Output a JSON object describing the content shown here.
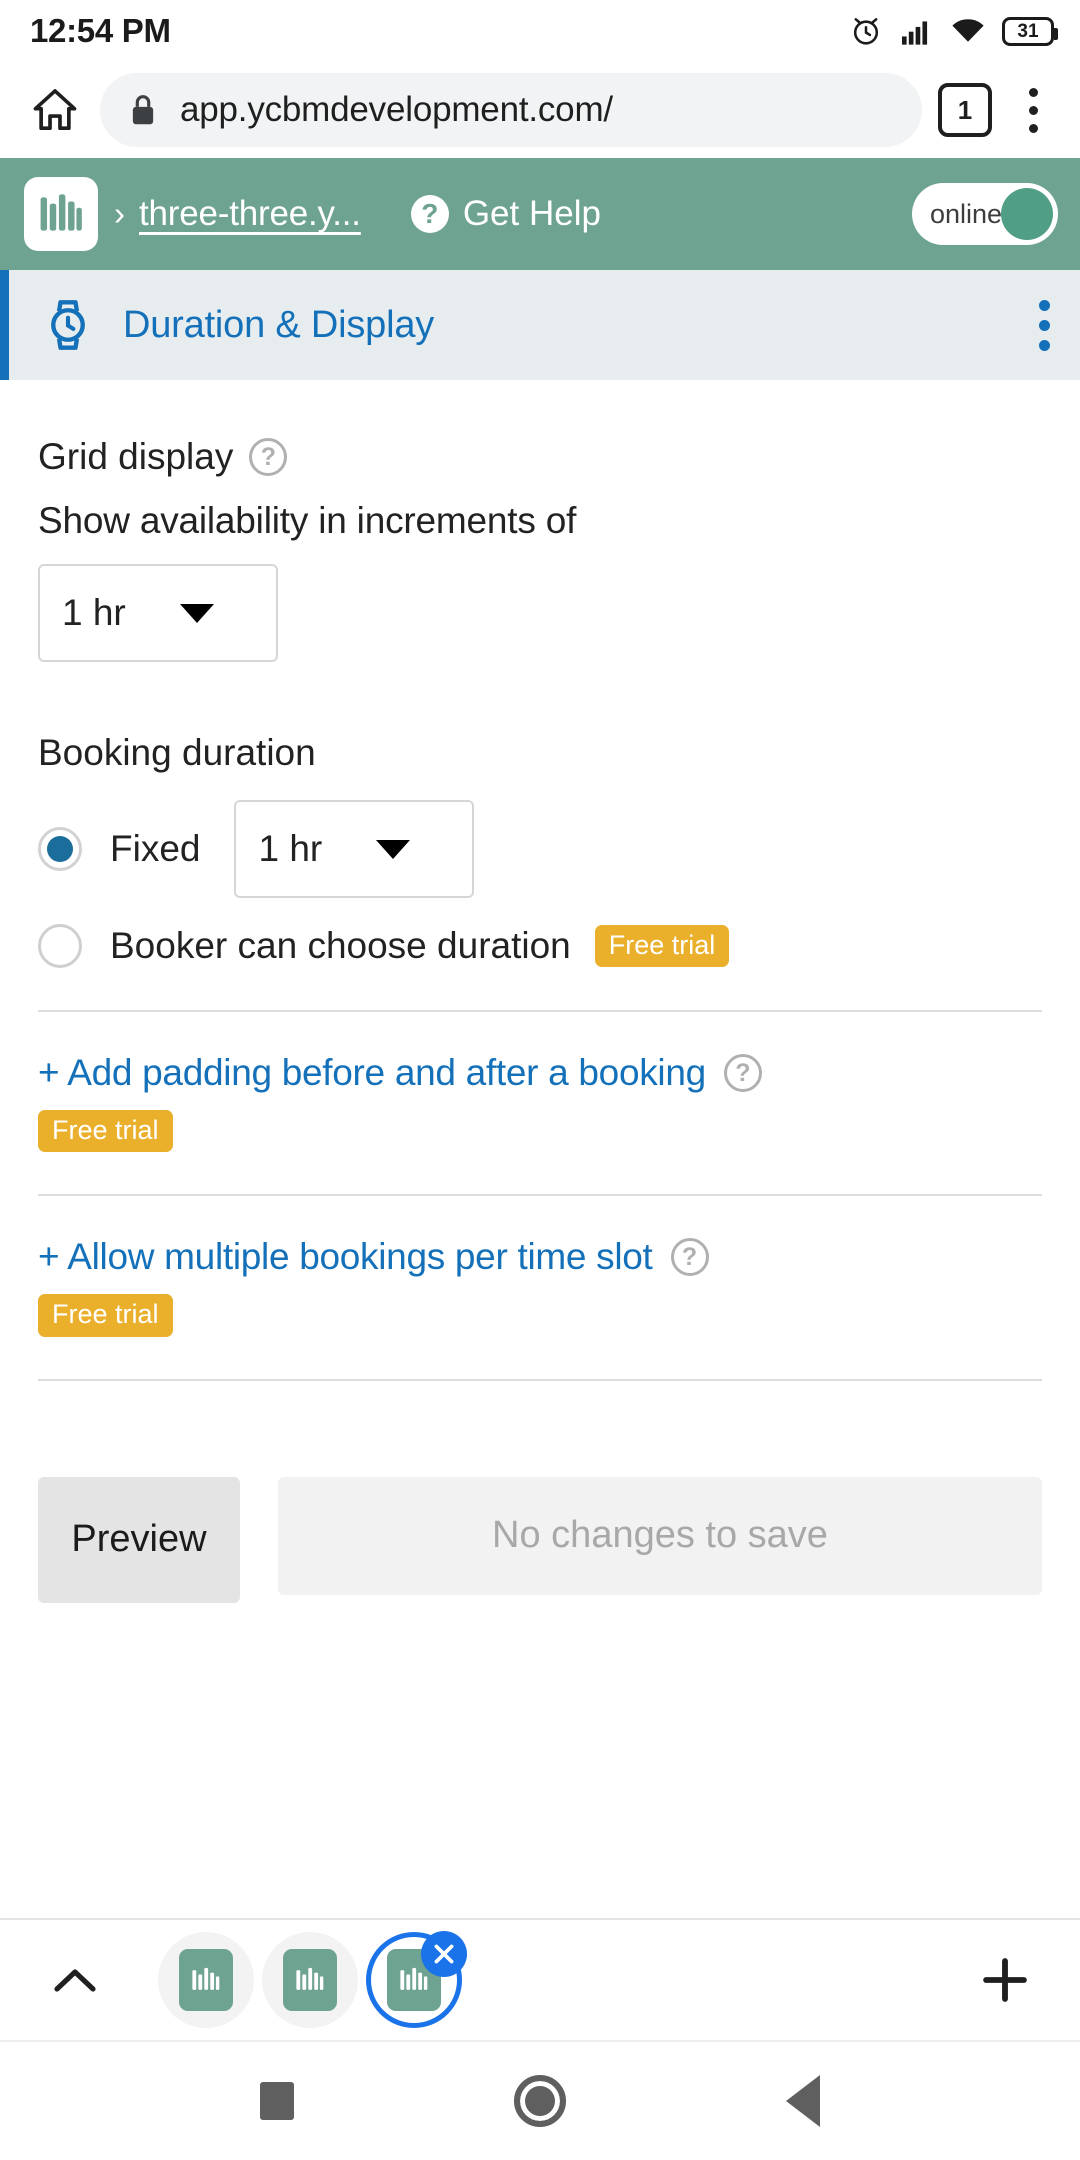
{
  "status_bar": {
    "time": "12:54 PM",
    "alarm_icon": "alarm-icon",
    "signal_icon": "cellular-signal-icon",
    "wifi_icon": "wifi-icon",
    "battery_level": "31"
  },
  "browser": {
    "home_icon": "home-icon",
    "lock_icon": "lock-icon",
    "url": "app.ycbmdevelopment.com/",
    "tab_count": "1",
    "menu_icon": "overflow-menu-icon"
  },
  "app_header": {
    "logo_icon": "ycbm-logo-icon",
    "separator": "›",
    "breadcrumb": "three-three.y...",
    "help_icon": "question-mark-icon",
    "help_label": "Get Help",
    "toggle_label": "online",
    "toggle_on": true,
    "background_color": "#6ea392"
  },
  "section": {
    "icon": "watch-icon",
    "title": "Duration & Display",
    "menu_icon": "vertical-dots-menu-icon",
    "accent_color": "#1471b9",
    "background_color": "#e7ecef"
  },
  "grid_display": {
    "label": "Grid display",
    "help_icon": "question-circle-icon",
    "sub_label": "Show availability in increments of",
    "increment_value": "1 hr",
    "caret_icon": "chevron-down-icon"
  },
  "booking_duration": {
    "title": "Booking duration",
    "fixed": {
      "label": "Fixed",
      "selected": true,
      "value": "1 hr",
      "caret_icon": "chevron-down-icon"
    },
    "booker_choose": {
      "label": "Booker can choose duration",
      "selected": false,
      "badge": "Free trial"
    }
  },
  "feature_links": [
    {
      "label": "+ Add padding before and after a booking",
      "help_icon": "question-circle-icon",
      "badge": "Free trial"
    },
    {
      "label": "+ Allow multiple bookings per time slot",
      "help_icon": "question-circle-icon",
      "badge": "Free trial"
    }
  ],
  "footer": {
    "preview_label": "Preview",
    "save_label": "No changes to save",
    "save_disabled": true
  },
  "tab_strip": {
    "expand_icon": "chevron-up-icon",
    "tabs": [
      {
        "icon": "ycbm-tab-icon",
        "active": false
      },
      {
        "icon": "ycbm-tab-icon",
        "active": false
      },
      {
        "icon": "ycbm-tab-icon",
        "active": true,
        "close_icon": "close-icon"
      }
    ],
    "new_tab_icon": "plus-icon"
  },
  "nav_bar": {
    "recents_icon": "recents-square-icon",
    "home_icon": "home-circle-icon",
    "back_icon": "back-triangle-icon"
  },
  "colors": {
    "brand_green": "#6ea392",
    "link_blue": "#1471b9",
    "badge_amber": "#eab02c",
    "chrome_blue": "#1a73e8"
  }
}
